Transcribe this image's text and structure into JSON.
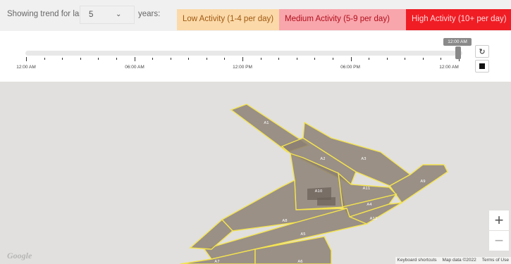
{
  "header": {
    "trend_label": "Showing trend for last",
    "years_value": "5",
    "trend_suffix": "years:",
    "legend": {
      "low": "Low Activity (1-4 per day)",
      "medium": "Medium Activity (5-9 per day)",
      "high": "High Activity (10+ per day)"
    },
    "colors": {
      "low": "#fbd9a9",
      "medium": "#f9a5ac",
      "high": "#f01d24"
    }
  },
  "timeline": {
    "labels": [
      "12:00 AM",
      "06:00 AM",
      "12:00 PM",
      "06:00 PM",
      "12:00 AM"
    ],
    "current_time": "12:00 AM",
    "reload_icon": "reload-icon",
    "stop_icon": "stop-icon"
  },
  "map": {
    "zone_labels": [
      "A1",
      "A2",
      "A3",
      "A9",
      "A10",
      "A11",
      "A4",
      "A12",
      "A8",
      "A5",
      "A7",
      "A6"
    ],
    "zoom_in": "+",
    "zoom_out": "−",
    "logo": "Google",
    "attribution": {
      "shortcuts": "Keyboard shortcuts",
      "data": "Map data ©2022",
      "terms": "Terms of Use"
    }
  }
}
